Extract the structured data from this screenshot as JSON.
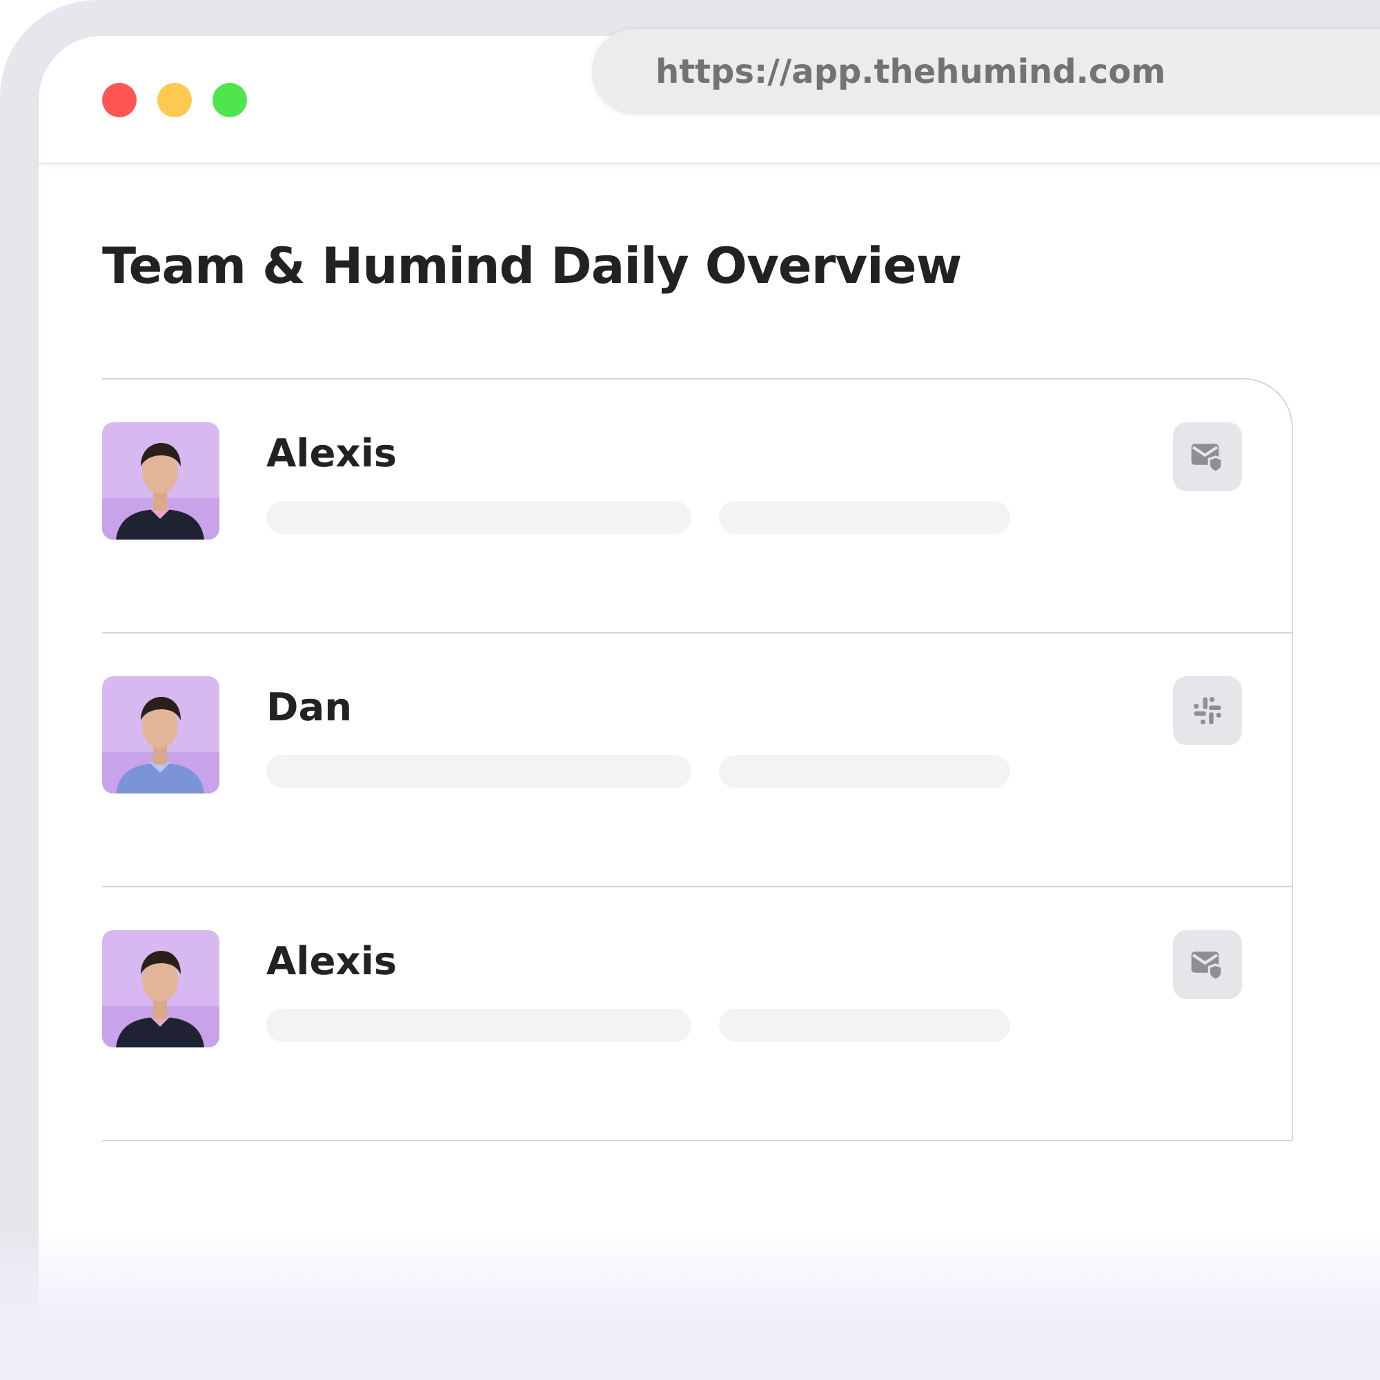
{
  "browser": {
    "url": "https://app.thehumind.com"
  },
  "page": {
    "title": "Team & Humind Daily Overview"
  },
  "people": [
    {
      "name": "Alexis",
      "badge": {
        "kind": "email"
      }
    },
    {
      "name": "Dan",
      "badge": {
        "kind": "slack"
      }
    },
    {
      "name": "Alexis",
      "badge": {
        "kind": "email"
      }
    }
  ]
}
